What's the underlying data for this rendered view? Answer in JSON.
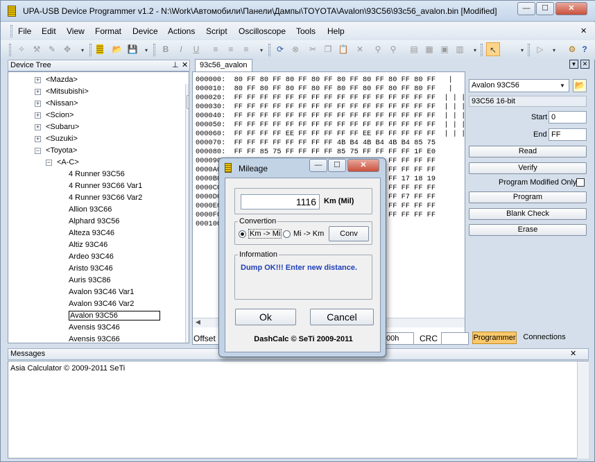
{
  "window": {
    "title": "UPA-USB Device Programmer v1.2 - N:\\Work\\Автомобили\\Панели\\Дампы\\TOYOTA\\Avalon\\93C56\\93c56_avalon.bin [Modified]",
    "min_label": "—",
    "max_label": "☐",
    "close_label": "✕"
  },
  "menu": {
    "items": [
      "File",
      "Edit",
      "View",
      "Format",
      "Device",
      "Actions",
      "Script",
      "Oscilloscope",
      "Tools",
      "Help"
    ],
    "close_label": "✕"
  },
  "toolbar": {
    "icons": [
      "wand-icon",
      "wand2-icon",
      "tools-icon",
      "move-icon",
      "chip-icon",
      "open-icon",
      "save-icon",
      "bold-icon",
      "italic-icon",
      "underline-icon",
      "align-left-icon",
      "align-center-icon",
      "align-right-icon",
      "refresh-icon",
      "stop-icon",
      "cut-icon",
      "copy-icon",
      "paste-icon",
      "delete-icon",
      "find-icon",
      "find-next-icon",
      "doc-icon",
      "doc2-icon",
      "doc3-icon",
      "doc4-icon",
      "cursor-icon",
      "play-icon",
      "step-icon",
      "settings-icon",
      "help-icon"
    ]
  },
  "device_tree": {
    "header": "Device Tree",
    "pin_label": "⊥",
    "close_label": "✕",
    "items": [
      {
        "label": "<Mazda>",
        "level": 0,
        "exp": "+"
      },
      {
        "label": "<Mitsubishi>",
        "level": 0,
        "exp": "+"
      },
      {
        "label": "<Nissan>",
        "level": 0,
        "exp": "+"
      },
      {
        "label": "<Scion>",
        "level": 0,
        "exp": "+"
      },
      {
        "label": "<Subaru>",
        "level": 0,
        "exp": "+"
      },
      {
        "label": "<Suzuki>",
        "level": 0,
        "exp": "+"
      },
      {
        "label": "<Toyota>",
        "level": 0,
        "exp": "−"
      },
      {
        "label": "<A-C>",
        "level": 1,
        "exp": "−"
      },
      {
        "label": "4 Runner 93C56",
        "level": 2,
        "exp": ""
      },
      {
        "label": "4 Runner 93C66 Var1",
        "level": 2,
        "exp": ""
      },
      {
        "label": "4 Runner 93C66 Var2",
        "level": 2,
        "exp": ""
      },
      {
        "label": "Allion 93C66",
        "level": 2,
        "exp": ""
      },
      {
        "label": "Alphard 93C56",
        "level": 2,
        "exp": ""
      },
      {
        "label": "Alteza 93C46",
        "level": 2,
        "exp": ""
      },
      {
        "label": "Altiz 93C46",
        "level": 2,
        "exp": ""
      },
      {
        "label": "Ardeo 93C46",
        "level": 2,
        "exp": ""
      },
      {
        "label": "Aristo 93C46",
        "level": 2,
        "exp": ""
      },
      {
        "label": "Auris 93C86",
        "level": 2,
        "exp": ""
      },
      {
        "label": "Avalon 93C46 Var1",
        "level": 2,
        "exp": ""
      },
      {
        "label": "Avalon 93C46 Var2",
        "level": 2,
        "exp": ""
      },
      {
        "label": "Avalon 93C56",
        "level": 2,
        "exp": "",
        "selected": true
      },
      {
        "label": "Avensis 93C46",
        "level": 2,
        "exp": ""
      },
      {
        "label": "Avensis 93C66",
        "level": 2,
        "exp": ""
      }
    ]
  },
  "editor": {
    "tab": "93c56_avalon",
    "close_label": "✕",
    "dropdown_label": "▼",
    "hex_lines": [
      "000000:  80 FF 80 FF 80 FF 80 FF 80 FF 80 FF 80 FF 80 FF   |   |   |",
      "000010:  80 FF 80 FF 80 FF 80 FF 80 FF 80 FF 80 FF 80 FF   |   |   |",
      "000020:  FF FF FF FF FF FF FF FF FF FF FF FF FF FF FF FF  | | | | | |",
      "000030:  FF FF FF FF FF FF FF FF FF FF FF FF FF FF FF FF  | | | | | |",
      "000040:  FF FF FF FF FF FF FF FF FF FF FF FF FF FF FF FF  | | | | | |",
      "000050:  FF FF FF FF FF FF FF FF FF FF FF FF FF FF FF FF  | | | | | |",
      "000060:  FF FF FF FF EE FF FF FF FF FF EE FF FF FF FF FF  | | | | | |",
      "000070:  FF FF FF FF FF FF FF FF 4B B4 4B B4 4B B4 85 75",
      "000080:  FF FF 85 75 FF FF FF FF 85 75 FF FF FF FF 1F E0",
      "000090:  FF FF FF FF FF FF FF FF FF FF FF FF FF FF FF FF",
      "0000A0:  FF FF FF FF FF FF FF FF FF FF FF FF FF FF FF FF",
      "0000B0:  FF FF FF FF FF FF FF FF FF FF FF FF FF 17 18 19",
      "0000C0:  FF FF FF FF FF FF FF FF FF FF FF FF FF FF FF FF",
      "0000D0:  FF FF FF FF FF FF FF FF FF FF FF FF FF F7 FF FF",
      "0000E0:  FF FF FF FF FF FF FF FF FF FF FF FF FF FF FF FF",
      "0000F0:  FF FF FF FF FF FF FF FF FF FF FF FF FF FF FF FF",
      "000100:"
    ],
    "offset_label": "Offset",
    "offset_value": "00h",
    "crc_label": "CRC",
    "crc_value": ""
  },
  "programmer": {
    "device": "Avalon 93C56",
    "device_info": "93C56 16-bit",
    "start_label": "Start",
    "start_value": "0",
    "end_label": "End",
    "end_value": "FF",
    "read_label": "Read",
    "verify_label": "Verify",
    "modified_label": "Program Modified Only",
    "program_label": "Program",
    "blank_label": "Blank Check",
    "erase_label": "Erase",
    "tabs": [
      "Programmer",
      "Connections"
    ]
  },
  "messages": {
    "header": "Messages",
    "close_label": "✕",
    "lines": [
      "Asia Calculator © 2009-2011 SeTi"
    ]
  },
  "dialog": {
    "title": "Mileage",
    "min_label": "—",
    "max_label": "☐",
    "close_label": "✕",
    "distance": "1116",
    "unit": "Km (Mil)",
    "conv_title": "Convertion",
    "opt1": "Km -> Mi",
    "opt2": "Mi -> Km",
    "conv_label": "Conv",
    "info_title": "Information",
    "info_text": "Dump OK!!! Enter new distance.",
    "ok_label": "Ok",
    "cancel_label": "Cancel",
    "footer": "DashCalc © SeTi 2009-2011"
  },
  "colors": {
    "accent": "#1f3fb8",
    "selected_border": "#000000",
    "tab_active": "#fbc96b"
  }
}
